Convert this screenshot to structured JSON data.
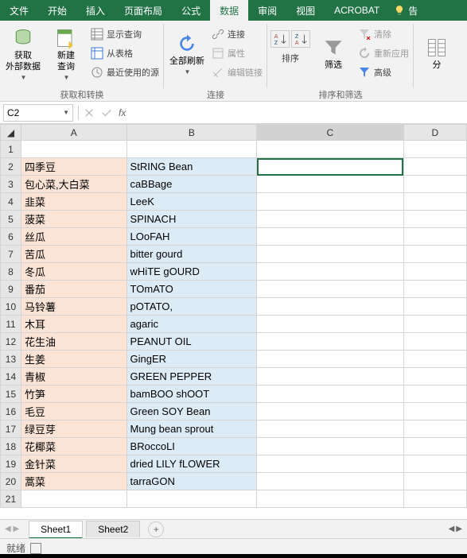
{
  "menu": {
    "file": "文件",
    "home": "开始",
    "insert": "插入",
    "pagelayout": "页面布局",
    "formulas": "公式",
    "data": "数据",
    "review": "审阅",
    "view": "视图",
    "acrobat": "ACROBAT",
    "tell": "告"
  },
  "ribbon": {
    "group1_label": "获取和转换",
    "group2_label": "连接",
    "group3_label": "排序和筛选",
    "ext_data": "获取\n外部数据",
    "new_query": "新建\n查询",
    "show_query": "显示查询",
    "from_table": "从表格",
    "recent_src": "最近使用的源",
    "refresh_all": "全部刷新",
    "connections": "连接",
    "properties": "属性",
    "edit_links": "编辑链接",
    "sort": "排序",
    "filter": "筛选",
    "clear": "清除",
    "reapply": "重新应用",
    "advanced": "高级",
    "split": "分"
  },
  "namebox": {
    "value": "C2",
    "fx": "fx"
  },
  "columns": [
    "A",
    "B",
    "C",
    "D"
  ],
  "rows": [
    {
      "n": 1,
      "a": "",
      "b": ""
    },
    {
      "n": 2,
      "a": "四季豆",
      "b": "StRING Bean"
    },
    {
      "n": 3,
      "a": "包心菜,大白菜",
      "b": "caBBage"
    },
    {
      "n": 4,
      "a": "韭菜",
      "b": "LeeK"
    },
    {
      "n": 5,
      "a": "菠菜",
      "b": "SPINACH"
    },
    {
      "n": 6,
      "a": "丝瓜",
      "b": "LOoFAH"
    },
    {
      "n": 7,
      "a": "苦瓜",
      "b": "bitter gourd"
    },
    {
      "n": 8,
      "a": "冬瓜",
      "b": "wHiTE gOURD"
    },
    {
      "n": 9,
      "a": "番茄",
      "b": "TOmATO"
    },
    {
      "n": 10,
      "a": "马铃薯",
      "b": "pOTATO,"
    },
    {
      "n": 11,
      "a": "木耳",
      "b": "agaric"
    },
    {
      "n": 12,
      "a": "花生油",
      "b": "PEANUT OIL"
    },
    {
      "n": 13,
      "a": "生姜",
      "b": "GingER"
    },
    {
      "n": 14,
      "a": "青椒",
      "b": "GREEN PEPPER"
    },
    {
      "n": 15,
      "a": "竹笋",
      "b": "bamBOO shOOT"
    },
    {
      "n": 16,
      "a": "毛豆",
      "b": "Green SOY Bean"
    },
    {
      "n": 17,
      "a": "绿豆芽",
      "b": "Mung bean sprout"
    },
    {
      "n": 18,
      "a": "花椰菜",
      "b": "BRoccoLI"
    },
    {
      "n": 19,
      "a": "金针菜",
      "b": "dried LILY fLOWER"
    },
    {
      "n": 20,
      "a": "蒿菜",
      "b": "tarraGON"
    },
    {
      "n": 21,
      "a": "",
      "b": ""
    }
  ],
  "sheets": {
    "s1": "Sheet1",
    "s2": "Sheet2"
  },
  "status": {
    "ready": "就绪"
  },
  "active_cell": "C2",
  "colors": {
    "accent": "#217346",
    "colA": "#fbe4d5",
    "colB": "#ddebf7"
  }
}
